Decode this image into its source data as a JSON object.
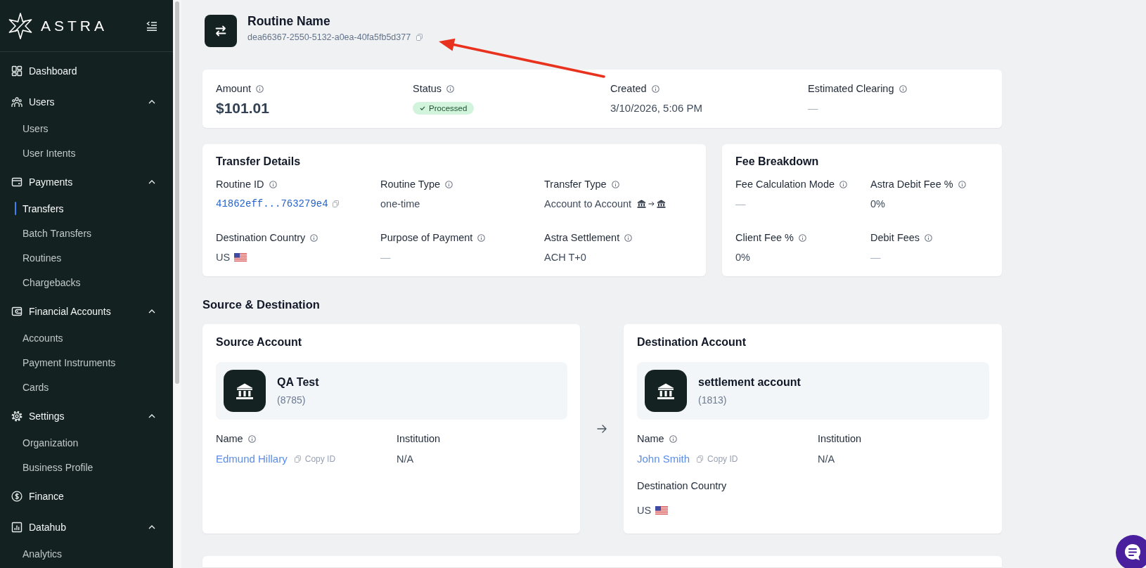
{
  "sidebar": {
    "brand": "ASTRA",
    "sections": [
      {
        "label": "Dashboard",
        "kind": "link",
        "selected": false
      },
      {
        "label": "Users",
        "kind": "group",
        "selected": false,
        "expanded": true,
        "children": [
          {
            "label": "Users",
            "selected": false
          },
          {
            "label": "User Intents",
            "selected": false
          }
        ]
      },
      {
        "label": "Payments",
        "kind": "group",
        "selected": false,
        "expanded": true,
        "children": [
          {
            "label": "Transfers",
            "selected": true
          },
          {
            "label": "Batch Transfers",
            "selected": false
          },
          {
            "label": "Routines",
            "selected": false
          },
          {
            "label": "Chargebacks",
            "selected": false
          }
        ]
      },
      {
        "label": "Financial Accounts",
        "kind": "group",
        "selected": false,
        "expanded": true,
        "children": [
          {
            "label": "Accounts",
            "selected": false
          },
          {
            "label": "Payment Instruments",
            "selected": false
          },
          {
            "label": "Cards",
            "selected": false
          }
        ]
      },
      {
        "label": "Settings",
        "kind": "group",
        "selected": false,
        "expanded": true,
        "children": [
          {
            "label": "Organization",
            "selected": false
          },
          {
            "label": "Business Profile",
            "selected": false
          }
        ]
      },
      {
        "label": "Finance",
        "kind": "link",
        "selected": false
      },
      {
        "label": "Datahub",
        "kind": "group",
        "selected": false,
        "expanded": true,
        "children": [
          {
            "label": "Analytics",
            "selected": false
          }
        ]
      }
    ]
  },
  "header": {
    "title": "Routine Name",
    "id": "dea66367-2550-5132-a0ea-40fa5fb5d377"
  },
  "summary": [
    {
      "label": "Amount",
      "info": true,
      "kind": "amount",
      "value": "$101.01"
    },
    {
      "label": "Status",
      "info": true,
      "kind": "badge",
      "value": "Processed"
    },
    {
      "label": "Created",
      "info": true,
      "kind": "text",
      "value": "3/10/2026, 5:06 PM"
    },
    {
      "label": "Estimated Clearing",
      "info": true,
      "kind": "empty",
      "value": "—"
    }
  ],
  "transfer_details": {
    "title": "Transfer Details",
    "fields": [
      {
        "label": "Routine ID",
        "info": true,
        "kind": "id",
        "value": "41862eff...763279e4"
      },
      {
        "label": "Routine Type",
        "info": true,
        "kind": "text",
        "value": "one-time"
      },
      {
        "label": "Transfer Type",
        "info": true,
        "kind": "transfer",
        "value": "Account to Account"
      },
      {
        "label": "Destination Country",
        "info": true,
        "kind": "country",
        "value": "US"
      },
      {
        "label": "Purpose of Payment",
        "info": true,
        "kind": "empty",
        "value": "—"
      },
      {
        "label": "Astra Settlement",
        "info": true,
        "kind": "text",
        "value": "ACH T+0"
      }
    ]
  },
  "fee_breakdown": {
    "title": "Fee Breakdown",
    "fields": [
      {
        "label": "Fee Calculation Mode",
        "info": true,
        "kind": "empty",
        "value": "—"
      },
      {
        "label": "Astra Debit Fee %",
        "info": true,
        "kind": "text",
        "value": "0%"
      },
      {
        "label": "Client Fee %",
        "info": true,
        "kind": "text",
        "value": "0%"
      },
      {
        "label": "Debit Fees",
        "info": true,
        "kind": "empty",
        "value": "—"
      }
    ]
  },
  "source_destination": {
    "title": "Source & Destination",
    "accounts": [
      {
        "title": "Source Account",
        "name": "QA Test",
        "number": "(8785)",
        "fields": [
          {
            "label": "Name",
            "info": true,
            "kind": "person",
            "value": "Edmund Hillary",
            "action": "Copy ID"
          },
          {
            "label": "Institution",
            "info": false,
            "kind": "text",
            "value": "N/A"
          }
        ]
      },
      {
        "title": "Destination Account",
        "name": "settlement account",
        "number": "(1813)",
        "fields": [
          {
            "label": "Name",
            "info": true,
            "kind": "person",
            "value": "John Smith",
            "action": "Copy ID"
          },
          {
            "label": "Institution",
            "info": false,
            "kind": "text",
            "value": "N/A"
          },
          {
            "label": "Destination Country",
            "info": false,
            "kind": "country",
            "value": "US"
          }
        ]
      }
    ]
  }
}
